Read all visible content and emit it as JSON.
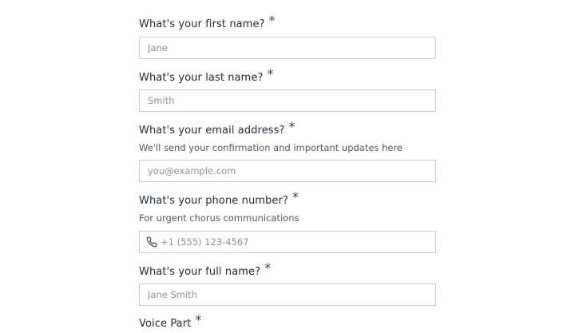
{
  "form": {
    "first_name": {
      "label": "What's your first name?",
      "required_mark": "*",
      "placeholder": "Jane"
    },
    "last_name": {
      "label": "What's your last name?",
      "required_mark": "*",
      "placeholder": "Smith"
    },
    "email": {
      "label": "What's your email address?",
      "required_mark": "*",
      "help": "We'll send your confirmation and important updates here",
      "placeholder": "you@example.com"
    },
    "phone": {
      "label": "What's your phone number?",
      "required_mark": "*",
      "help": "For urgent chorus communications",
      "placeholder": "+1 (555) 123-4567",
      "icon": "phone-icon"
    },
    "full_name": {
      "label": "What's your full name?",
      "required_mark": "*",
      "placeholder": "Jane Smith"
    },
    "next_field": {
      "label": "Voice Part",
      "required_mark": "*"
    }
  }
}
